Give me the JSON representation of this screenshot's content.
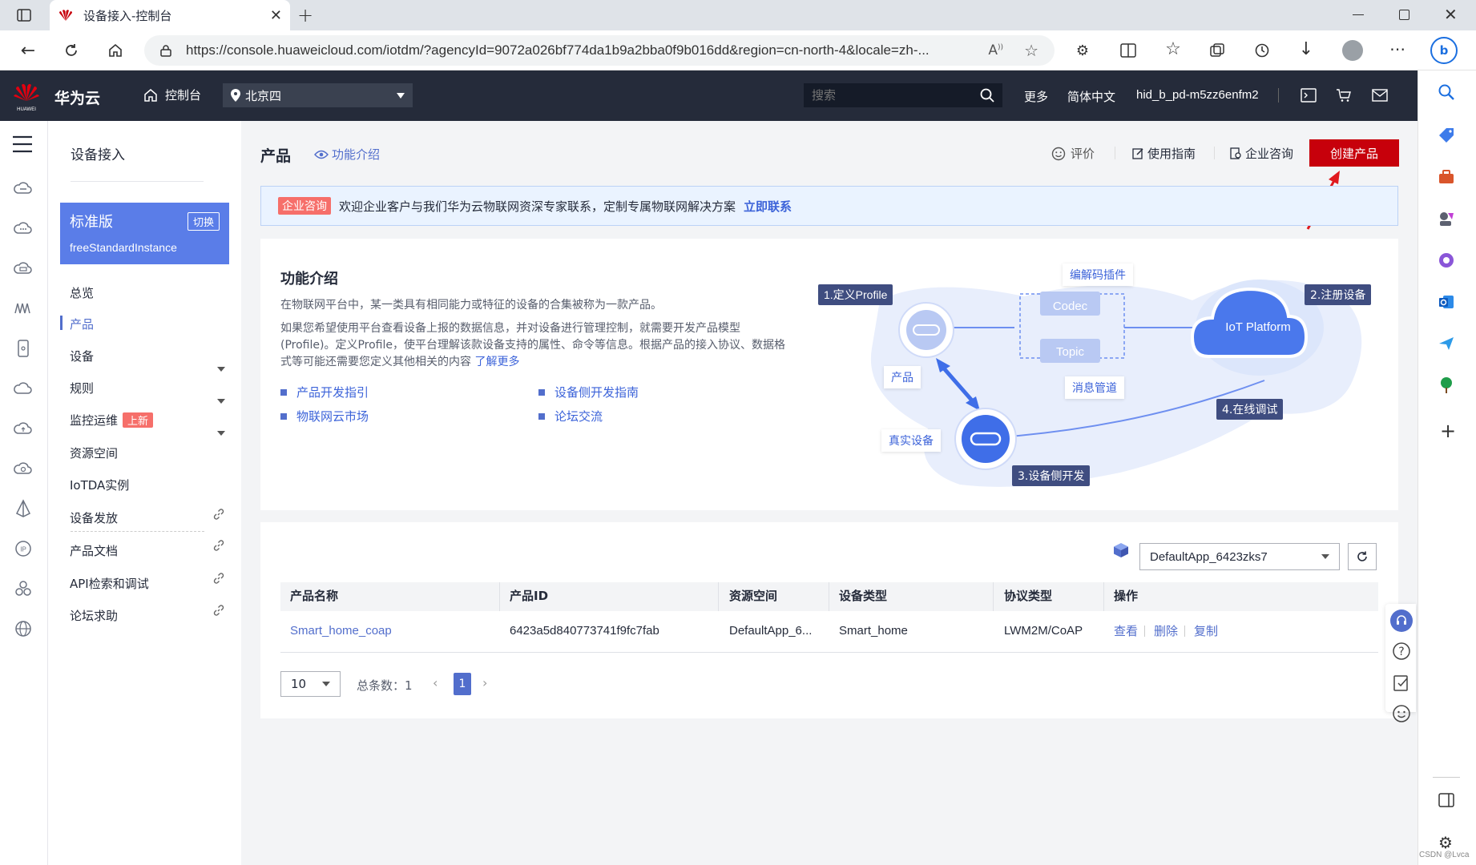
{
  "browser": {
    "tab_title": "设备接入-控制台",
    "url": "https://console.huaweicloud.com/iotdm/?agencyId=9072a026bf774da1b9a2bba0f9b016dd&region=cn-north-4&locale=zh-..."
  },
  "header": {
    "brand_text": "华为云",
    "console_label": "控制台",
    "region": "北京四",
    "search_placeholder": "搜索",
    "more": "更多",
    "language": "简体中文",
    "user": "hid_b_pd-m5zz6enfm2"
  },
  "sidemenu": {
    "title": "设备接入",
    "edition": {
      "name": "标准版",
      "switch_label": "切换",
      "instance": "freeStandardInstance"
    },
    "items": [
      {
        "label": "总览"
      },
      {
        "label": "产品"
      },
      {
        "label": "设备"
      },
      {
        "label": "规则"
      },
      {
        "label": "监控运维",
        "badge": "上新"
      },
      {
        "label": "资源空间"
      },
      {
        "label": "IoTDA实例"
      },
      {
        "label": "设备发放"
      },
      {
        "label": "产品文档"
      },
      {
        "label": "API检索和调试"
      },
      {
        "label": "论坛求助"
      }
    ]
  },
  "page": {
    "title": "产品",
    "feature_link": "功能介绍",
    "actions": {
      "rate": "评价",
      "guide": "使用指南",
      "consult": "企业咨询",
      "create": "创建产品"
    }
  },
  "banner": {
    "tag": "企业咨询",
    "text": "欢迎企业客户与我们华为云物联网资深专家联系，定制专属物联网解决方案",
    "link": "立即联系"
  },
  "intro": {
    "title": "功能介绍",
    "p1": "在物联网平台中，某一类具有相同能力或特征的设备的合集被称为一款产品。",
    "p2": "如果您希望使用平台查看设备上报的数据信息，并对设备进行管理控制，就需要开发产品模型(Profile)。定义Profile，使平台理解该款设备支持的属性、命令等信息。根据产品的接入协议、数据格式等可能还需要您定义其他相关的内容",
    "learn_more": "了解更多",
    "links": [
      "产品开发指引",
      "设备侧开发指南",
      "物联网云市场",
      "论坛交流"
    ],
    "diagram": {
      "step1": "1.定义Profile",
      "step2": "2.注册设备",
      "step3": "3.设备侧开发",
      "step4": "4.在线调试",
      "codec_plugin": "编解码插件",
      "codec": "Codec",
      "topic": "Topic",
      "msg_pipe": "消息管道",
      "product": "产品",
      "real_device": "真实设备",
      "platform": "IoT Platform"
    }
  },
  "table": {
    "app_select": "DefaultApp_6423zks7",
    "columns": [
      "产品名称",
      "产品ID",
      "资源空间",
      "设备类型",
      "协议类型",
      "操作"
    ],
    "rows": [
      {
        "name": "Smart_home_coap",
        "id": "6423a5d840773741f9fc7fab",
        "space": "DefaultApp_6...",
        "type": "Smart_home",
        "protocol": "LWM2M/CoAP",
        "ops": [
          "查看",
          "删除",
          "复制"
        ]
      }
    ]
  },
  "pagination": {
    "page_size": "10",
    "total_label": "总条数：1",
    "current": "1"
  },
  "watermark": "CSDN @Lvca",
  "colors": {
    "accent": "#526ecc",
    "danger": "#c7000b",
    "topbar": "#252b3a",
    "edition": "#5a7de8"
  }
}
